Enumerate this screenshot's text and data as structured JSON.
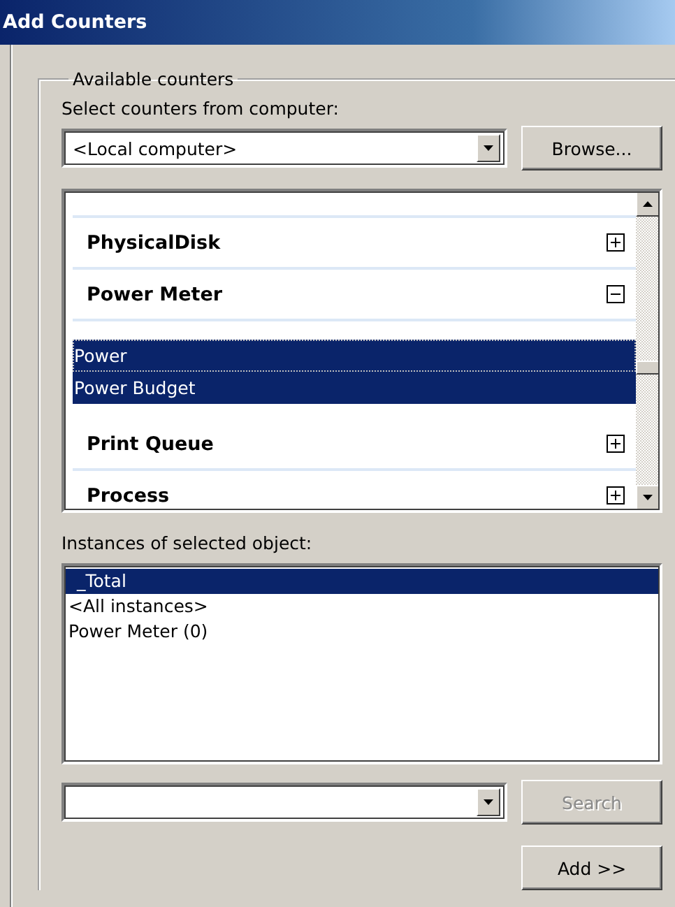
{
  "window": {
    "title": "Add Counters"
  },
  "available_counters": {
    "label": "Available counters",
    "computer_label": "Select counters from computer:",
    "computer": {
      "value": "<Local computer>"
    },
    "browse_button": "Browse...",
    "objects": [
      {
        "name": "PhysicalDisk",
        "expanded": false
      },
      {
        "name": "Power Meter",
        "expanded": true,
        "children": [
          {
            "name": "Power",
            "selected": true,
            "focused": true
          },
          {
            "name": "Power Budget",
            "selected": true,
            "focused": false
          }
        ]
      },
      {
        "name": "Print Queue",
        "expanded": false
      },
      {
        "name": "Process",
        "expanded": false
      }
    ],
    "instances_label": "Instances of selected object:",
    "instances": [
      {
        "name": "_Total",
        "selected": true
      },
      {
        "name": "<All instances>",
        "selected": false
      },
      {
        "name": "Power Meter (0)",
        "selected": false
      }
    ],
    "search_button": {
      "label": "Search",
      "disabled": true
    },
    "add_button": "Add >>"
  }
}
